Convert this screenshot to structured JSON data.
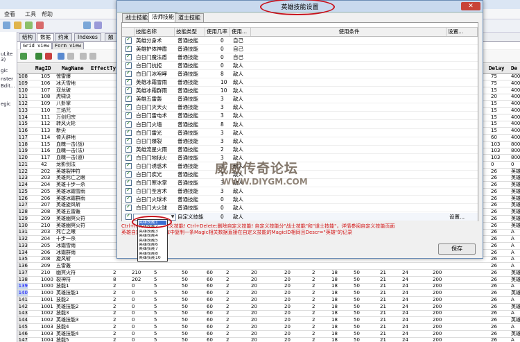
{
  "background_app": {
    "menu": [
      "查看",
      "工具",
      "帮助"
    ],
    "left_panel": [
      "uLite 3)",
      "gic",
      "nster",
      "Bdit...",
      "egic"
    ],
    "tabs": [
      {
        "label": "结构",
        "active": false
      },
      {
        "label": "数据",
        "active": true
      },
      {
        "label": "约束",
        "active": false
      },
      {
        "label": "Indexes",
        "active": false
      },
      {
        "label": "触",
        "active": false
      }
    ],
    "subtabs": [
      {
        "label": "Grid view",
        "active": true
      },
      {
        "label": "Form view",
        "active": false
      }
    ],
    "grid_headers": [
      "MagID",
      "MagName",
      "EffectTy",
      "Delay",
      "De"
    ],
    "rows": [
      {
        "rn": "108",
        "id": "105",
        "name": "惊雷爆",
        "c": [],
        "delay": "75",
        "de": "400"
      },
      {
        "rn": "109",
        "id": "106",
        "name": "冰天雪地",
        "c": [],
        "delay": "75",
        "de": "400"
      },
      {
        "rn": "110",
        "id": "107",
        "name": "双龙破",
        "c": [],
        "delay": "15",
        "de": "400"
      },
      {
        "rn": "111",
        "id": "108",
        "name": "虎啸诀",
        "c": [],
        "delay": "20",
        "de": "400"
      },
      {
        "rn": "112",
        "id": "109",
        "name": "八卦掌",
        "c": [],
        "delay": "15",
        "de": "400"
      },
      {
        "rn": "113",
        "id": "110",
        "name": "三焰咒",
        "c": [],
        "delay": "15",
        "de": "400"
      },
      {
        "rn": "114",
        "id": "111",
        "name": "万剑归宗",
        "c": [],
        "delay": "15",
        "de": "400"
      },
      {
        "rn": "115",
        "id": "112",
        "name": "转风火轮",
        "c": [],
        "delay": "15",
        "de": "400"
      },
      {
        "rn": "116",
        "id": "113",
        "name": "新尖",
        "c": [],
        "delay": "15",
        "de": "400"
      },
      {
        "rn": "117",
        "id": "114",
        "name": "倚天辟地",
        "c": [],
        "delay": "60",
        "de": "400"
      },
      {
        "rn": "118",
        "id": "115",
        "name": "血魄一击(战)",
        "c": [],
        "delay": "103",
        "de": "800"
      },
      {
        "rn": "119",
        "id": "116",
        "name": "血魄一击(法)",
        "c": [],
        "delay": "103",
        "de": "800"
      },
      {
        "rn": "120",
        "id": "117",
        "name": "血魄一击(道)",
        "c": [],
        "delay": "103",
        "de": "800"
      },
      {
        "rn": "121",
        "id": "42",
        "name": "龙影剑法",
        "c": [],
        "delay": "0",
        "de": "0"
      },
      {
        "rn": "122",
        "id": "202",
        "name": "英雄裂神符",
        "c": [],
        "delay": "26",
        "de": "英雄"
      },
      {
        "rn": "123",
        "id": "203",
        "name": "英雄死亡之眼",
        "c": [],
        "delay": "26",
        "de": "英雄"
      },
      {
        "rn": "124",
        "id": "204",
        "name": "英雄十步一杀",
        "c": [],
        "delay": "26",
        "de": "英雄"
      },
      {
        "rn": "125",
        "id": "205",
        "name": "英雄冰霜雪雨",
        "c": [],
        "delay": "26",
        "de": "英雄"
      },
      {
        "rn": "126",
        "id": "206",
        "name": "英雄冰霜群雨",
        "c": [],
        "delay": "26",
        "de": "英雄"
      },
      {
        "rn": "127",
        "id": "207",
        "name": "英雄旋风斩",
        "c": [],
        "delay": "26",
        "de": "英雄"
      },
      {
        "rn": "128",
        "id": "208",
        "name": "英雄五雷轰",
        "c": [],
        "delay": "26",
        "de": "英雄"
      },
      {
        "rn": "129",
        "id": "209",
        "name": "英雄幽冥火符",
        "c": [],
        "delay": "26",
        "de": "英雄"
      },
      {
        "rn": "130",
        "id": "210",
        "name": "英雄幽冥火符",
        "c": [],
        "delay": "26",
        "de": "英雄"
      },
      {
        "rn": "131",
        "id": "203",
        "name": "死亡之眼",
        "c": [],
        "delay": "26",
        "de": "A"
      },
      {
        "rn": "132",
        "id": "204",
        "name": "十步一杀",
        "c": [],
        "delay": "26",
        "de": "A"
      },
      {
        "rn": "133",
        "id": "205",
        "name": "冰霜雪雨",
        "c": [],
        "delay": "26",
        "de": "A"
      },
      {
        "rn": "134",
        "id": "206",
        "name": "冰霜群雨",
        "c": [],
        "delay": "26",
        "de": "A"
      },
      {
        "rn": "135",
        "id": "208",
        "name": "旋风斩",
        "c": [],
        "delay": "26",
        "de": "A"
      },
      {
        "rn": "136",
        "id": "209",
        "name": "五雷轰",
        "c": [],
        "delay": "26",
        "de": "A"
      },
      {
        "rn": "137",
        "id": "210",
        "name": "幽冥火符",
        "c": [
          "2",
          "210",
          "5",
          "50",
          "60",
          "2",
          "20",
          "20",
          "2",
          "18",
          "50",
          "21",
          "24",
          "200"
        ],
        "delay": "26",
        "de": "英雄"
      },
      {
        "rn": "138",
        "id": "1000",
        "name": "裂神符",
        "c": [
          "8",
          "202",
          "5",
          "50",
          "60",
          "2",
          "20",
          "20",
          "2",
          "18",
          "50",
          "21",
          "24",
          "200"
        ],
        "delay": "26",
        "de": "英雄"
      },
      {
        "rn": "139",
        "id": "1000",
        "name": "技能1",
        "c": [
          "2",
          "0",
          "5",
          "50",
          "60",
          "2",
          "20",
          "20",
          "2",
          "18",
          "50",
          "21",
          "24",
          "200"
        ],
        "delay": "26",
        "de": "A",
        "sel": true
      },
      {
        "rn": "140",
        "id": "1000",
        "name": "英雄技能1",
        "c": [
          "2",
          "0",
          "5",
          "50",
          "60",
          "2",
          "20",
          "20",
          "2",
          "18",
          "50",
          "21",
          "24",
          "200"
        ],
        "delay": "26",
        "de": "英雄",
        "sel": true
      },
      {
        "rn": "141",
        "id": "1001",
        "name": "技能2",
        "c": [
          "2",
          "0",
          "5",
          "50",
          "60",
          "2",
          "20",
          "20",
          "2",
          "18",
          "50",
          "21",
          "24",
          "200"
        ],
        "delay": "26",
        "de": "A"
      },
      {
        "rn": "142",
        "id": "1001",
        "name": "英雄技能2",
        "c": [
          "2",
          "0",
          "5",
          "50",
          "60",
          "2",
          "20",
          "20",
          "2",
          "18",
          "50",
          "21",
          "24",
          "200"
        ],
        "delay": "26",
        "de": "英雄"
      },
      {
        "rn": "143",
        "id": "1002",
        "name": "技能3",
        "c": [
          "2",
          "0",
          "5",
          "50",
          "60",
          "2",
          "20",
          "20",
          "2",
          "18",
          "50",
          "21",
          "24",
          "200"
        ],
        "delay": "26",
        "de": "A"
      },
      {
        "rn": "144",
        "id": "1002",
        "name": "英雄技能3",
        "c": [
          "2",
          "0",
          "5",
          "50",
          "60",
          "2",
          "20",
          "20",
          "2",
          "18",
          "50",
          "21",
          "24",
          "200"
        ],
        "delay": "26",
        "de": "英雄"
      },
      {
        "rn": "145",
        "id": "1003",
        "name": "技能4",
        "c": [
          "2",
          "0",
          "5",
          "50",
          "60",
          "2",
          "20",
          "20",
          "2",
          "18",
          "50",
          "21",
          "24",
          "200"
        ],
        "delay": "26",
        "de": "A"
      },
      {
        "rn": "146",
        "id": "1003",
        "name": "英雄技能4",
        "c": [
          "2",
          "0",
          "5",
          "50",
          "60",
          "2",
          "20",
          "20",
          "2",
          "18",
          "50",
          "21",
          "24",
          "200"
        ],
        "delay": "26",
        "de": "英雄"
      },
      {
        "rn": "147",
        "id": "1004",
        "name": "技能5",
        "c": [
          "2",
          "0",
          "5",
          "50",
          "60",
          "2",
          "20",
          "20",
          "2",
          "18",
          "50",
          "21",
          "24",
          "200"
        ],
        "delay": "26",
        "de": "A"
      }
    ]
  },
  "dialog": {
    "title": "英雄技能设置",
    "close_label": "✕",
    "tabs": [
      {
        "label": "战士技能",
        "active": false
      },
      {
        "label": "法师技能",
        "active": true
      },
      {
        "label": "道士技能",
        "active": false
      }
    ],
    "columns": [
      "技能名称",
      "技能类型",
      "使用几率",
      "使用...",
      "使用条件",
      "设置..."
    ],
    "skills": [
      {
        "name": "英雄分身术",
        "type": "普通技能",
        "rate": "0",
        "target": "自己"
      },
      {
        "name": "英雄护体神盾",
        "type": "普通技能",
        "rate": "0",
        "target": "自己"
      },
      {
        "name": "白日门魔法盾",
        "type": "普通技能",
        "rate": "0",
        "target": "自己"
      },
      {
        "name": "白日门抗拒",
        "type": "普通技能",
        "rate": "0",
        "target": "敌人"
      },
      {
        "name": "白日门冰咆哮",
        "type": "普通技能",
        "rate": "8",
        "target": "敌人"
      },
      {
        "name": "英雄冰霜雪雨",
        "type": "普通技能",
        "rate": "10",
        "target": "敌人"
      },
      {
        "name": "英雄冰霜群雨",
        "type": "普通技能",
        "rate": "10",
        "target": "敌人"
      },
      {
        "name": "英雄五雷轰",
        "type": "普通技能",
        "rate": "3",
        "target": "敌人"
      },
      {
        "name": "白日门灭天火",
        "type": "普通技能",
        "rate": "3",
        "target": "敌人"
      },
      {
        "name": "白日门雷电术",
        "type": "普通技能",
        "rate": "3",
        "target": "敌人"
      },
      {
        "name": "白日门火墙",
        "type": "普通技能",
        "rate": "8",
        "target": "敌人"
      },
      {
        "name": "白日门雷光",
        "type": "普通技能",
        "rate": "3",
        "target": "敌人"
      },
      {
        "name": "白日门爆裂",
        "type": "普通技能",
        "rate": "3",
        "target": "敌人"
      },
      {
        "name": "英雄流星火雨",
        "type": "普通技能",
        "rate": "2",
        "target": "敌人"
      },
      {
        "name": "白日门地狱火",
        "type": "普通技能",
        "rate": "3",
        "target": "敌人"
      },
      {
        "name": "白日门诱惑术",
        "type": "普通技能",
        "rate": "3",
        "target": "敌人"
      },
      {
        "name": "白日门疾光",
        "type": "普通技能",
        "rate": "3",
        "target": "敌人"
      },
      {
        "name": "白日门寒冰掌",
        "type": "普通技能",
        "rate": "3",
        "target": "敌人"
      },
      {
        "name": "白日门圣言术",
        "type": "普通技能",
        "rate": "3",
        "target": "敌人"
      },
      {
        "name": "白日门火球术",
        "type": "普通技能",
        "rate": "0",
        "target": "敌人"
      },
      {
        "name": "白日门大火球",
        "type": "普通技能",
        "rate": "0",
        "target": "敌人"
      }
    ],
    "custom_row": {
      "type": "自定义技能",
      "rate": "0",
      "target": "敌人",
      "settings": "设置..."
    },
    "settings_label": "设置...",
    "dropdown_options": [
      {
        "label": "英雄技能1",
        "highlighted": true
      },
      {
        "label": "英雄技能2",
        "highlighted": false
      },
      {
        "label": "英雄技能3",
        "highlighted": false
      },
      {
        "label": "英雄技能4",
        "highlighted": false
      },
      {
        "label": "英雄技能5",
        "highlighted": false
      },
      {
        "label": "英雄技能6",
        "highlighted": false
      },
      {
        "label": "英雄技能7",
        "highlighted": false
      },
      {
        "label": "英雄技能8",
        "highlighted": false
      },
      {
        "label": "英雄技能10",
        "highlighted": false
      }
    ],
    "hint_line1": "Ctrl+Insert:添加自定义技能! Ctrl+Delete:删除自定义技能! 自定义技能分\"战士技能\"和\"道士技能\"，详情参阅自定义技能页面",
    "hint_line2": "英雄自定义技能数据库中复制一条Magic相关数据直接在自定义技能的MagicID相同且Descr=\"英雄\"的记录",
    "save_label": "保存"
  },
  "watermark": {
    "title": "威威传奇论坛",
    "url": "WWW.DIYGM.COM"
  }
}
